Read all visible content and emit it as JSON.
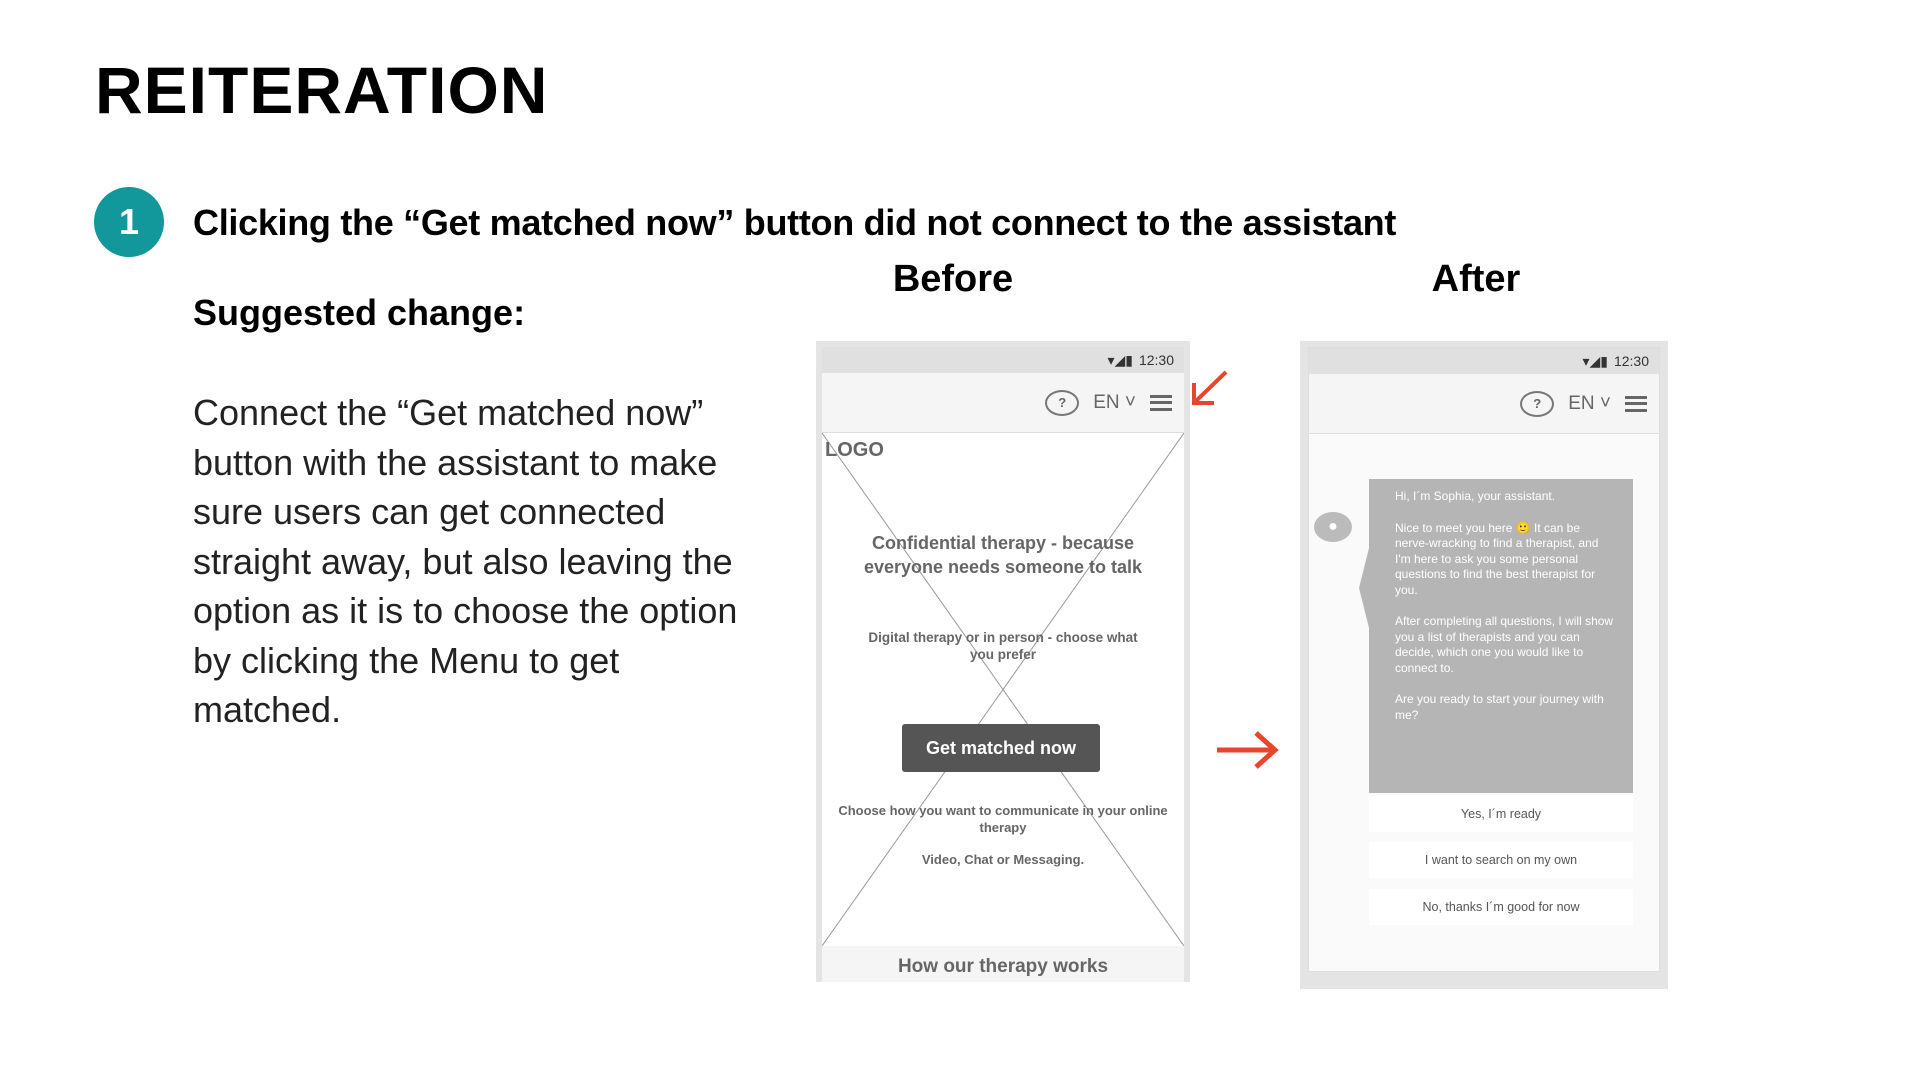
{
  "title": "REITERATION",
  "issue": {
    "number": "1",
    "text": "Clicking the “Get matched now” button did not connect to the assistant"
  },
  "suggestion": {
    "label": "Suggested change:",
    "text": "Connect the “Get matched now” button with the assistant to make sure users can get connected straight away, but also leaving the option as it is to choose the option by clicking the Menu to get matched."
  },
  "before": {
    "label": "Before",
    "time": "12:30",
    "lang": "EN",
    "logo": "LOGO",
    "headline": "Confidential therapy - because everyone needs someone to talk",
    "subtitle": "Digital therapy or in person - choose what you prefer",
    "cta": "Get matched now",
    "choose": "Choose how you want to communicate in your online therapy",
    "modes": "Video, Chat or Messaging.",
    "footer": "How our therapy works"
  },
  "after": {
    "label": "After",
    "time": "12:30",
    "lang": "EN",
    "messages": [
      "Hi, I´m Sophia, your assistant.",
      "Nice to meet you here 🙂 It can be nerve-wracking to find a therapist, and I'm here to ask you some personal questions to find the best therapist for you.",
      "After completing all questions, I will show you a list of therapists and you can decide, which one you would like to connect to.",
      "Are you ready to start your journey with me?"
    ],
    "options": [
      "Yes, I´m ready",
      "I want to search on my own",
      "No, thanks I´m good for now"
    ]
  },
  "colors": {
    "accent": "#12979b",
    "arrow": "#e8452c",
    "button": "#555555",
    "bubble": "#b5b5b5"
  }
}
